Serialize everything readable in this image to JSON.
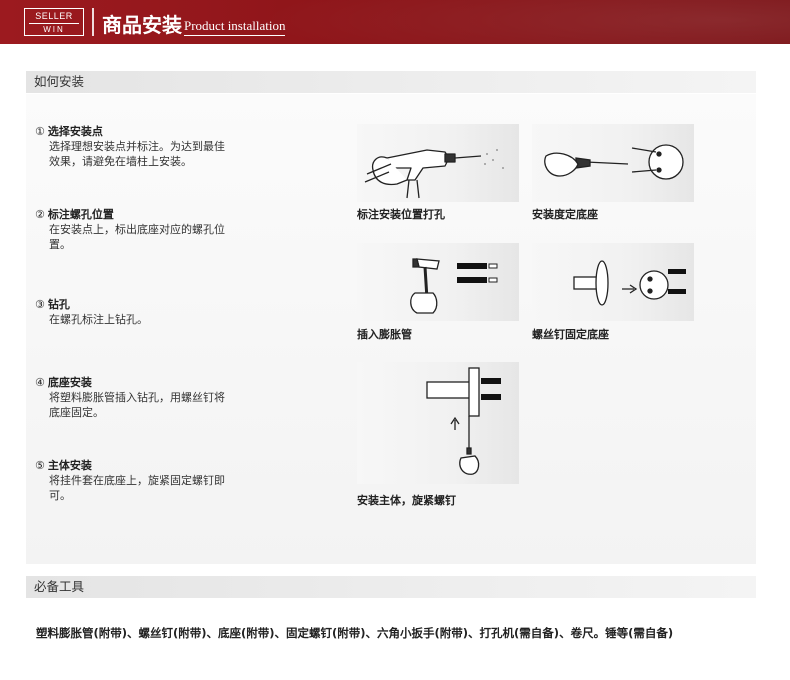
{
  "banner": {
    "logo_top": "SELLER",
    "logo_bottom": "WIN",
    "title_cn": "商品安装",
    "title_en": "Product installation"
  },
  "sections": {
    "how_to_install": "如何安装",
    "required_tools": "必备工具"
  },
  "steps": [
    {
      "num": "①",
      "title": "选择安装点",
      "desc": "选择理想安装点并标注。为达到最佳效果，请避免在墙柱上安装。"
    },
    {
      "num": "②",
      "title": "标注螺孔位置",
      "desc": "在安装点上，标出底座对应的螺孔位置。"
    },
    {
      "num": "③",
      "title": "钻孔",
      "desc": "在螺孔标注上钻孔。"
    },
    {
      "num": "④",
      "title": "底座安装",
      "desc": "将塑料膨胀管插入钻孔，用螺丝钉将底座固定。"
    },
    {
      "num": "⑤",
      "title": "主体安装",
      "desc": "将挂件套在底座上，旋紧固定螺钉即可。"
    }
  ],
  "illustrations": [
    {
      "caption": "标注安装位置打孔",
      "icon": "drill-icon"
    },
    {
      "caption": "安装度定底座",
      "icon": "screwdriver-icon"
    },
    {
      "caption": "插入膨胀管",
      "icon": "hammer-icon"
    },
    {
      "caption": "螺丝钉固定底座",
      "icon": "base-screw-icon"
    },
    {
      "caption": "安装主体，旋紧螺钉",
      "icon": "mount-body-icon"
    }
  ],
  "tools_text": "塑料膨胀管(附带)、螺丝钉(附带)、底座(附带)、固定螺钉(附带)、六角小扳手(附带)、打孔机(需自备)、卷尺。锤等(需自备)",
  "colors": {
    "banner": "#8a1418",
    "section_bar": "#e6e6e6"
  }
}
